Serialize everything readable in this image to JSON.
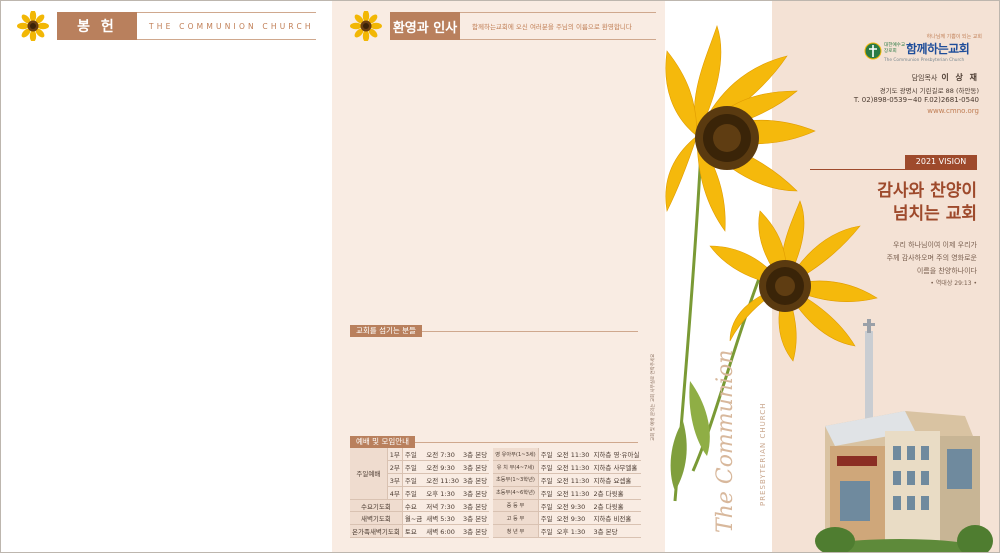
{
  "offering": {
    "tab_label": "봉 헌",
    "subtitle": "THE COMMUNION CHURCH"
  },
  "welcome": {
    "tab_label": "환영과 인사",
    "subtitle": "함께하는교회에 오신 여러분을 주님의 이름으로 환영합니다",
    "serve_section": "교회를 섬기는 분들",
    "worship_section": "예배 및 모임안내",
    "side_note": "교회 및 예배 문의는 교회 사무실로 연락주세요"
  },
  "schedule": {
    "left": [
      {
        "cat": "주일예배",
        "sub": "1부",
        "day": "주일",
        "time": "오전 7:30",
        "place": "3층 본당"
      },
      {
        "cat": "",
        "sub": "2부",
        "day": "주일",
        "time": "오전 9:30",
        "place": "3층 본당"
      },
      {
        "cat": "",
        "sub": "3부",
        "day": "주일",
        "time": "오전 11:30",
        "place": "3층 본당"
      },
      {
        "cat": "",
        "sub": "4부",
        "day": "주일",
        "time": "오후 1:30",
        "place": "3층 본당"
      },
      {
        "cat": "수요기도회",
        "sub": "",
        "day": "수요",
        "time": "저녁 7:30",
        "place": "3층 본당"
      },
      {
        "cat": "새벽기도회",
        "sub": "",
        "day": "월~금",
        "time": "새벽 5:30",
        "place": "3층 본당"
      },
      {
        "cat": "온가족새벽기도회",
        "sub": "",
        "day": "토요",
        "time": "새벽 6:00",
        "place": "3층 본당"
      }
    ],
    "right": [
      {
        "cat": "영 유아부(1~3세)",
        "day": "주일",
        "time": "오전 11:30",
        "place": "지하층 영·유아실"
      },
      {
        "cat": "유 치 부(4~7세)",
        "day": "주일",
        "time": "오전 11:30",
        "place": "지하층 사무엘홀"
      },
      {
        "cat": "초등부(1~3학년)",
        "day": "주일",
        "time": "오전 11:30",
        "place": "지하층 요셉홀"
      },
      {
        "cat": "초등부(4~6학년)",
        "day": "주일",
        "time": "오전 11:30",
        "place": "2층 다윗홀"
      },
      {
        "cat": "중 등 부",
        "day": "주일",
        "time": "오전 9:30",
        "place": "2층 다윗홀"
      },
      {
        "cat": "고 등 부",
        "day": "주일",
        "time": "오전 9:30",
        "place": "지하층 비전홀"
      },
      {
        "cat": "청 년 부",
        "day": "주일",
        "time": "오후 1:30",
        "place": "3층 본당"
      }
    ]
  },
  "cover": {
    "slogan": "하나님께 기쁨이 되는 교회",
    "denomination": "대한예수교 장로회",
    "church_name": "함께하는교회",
    "church_name_en": "The Communion Presbyterian Church",
    "pastor_label": "담임목사",
    "pastor_name": "이 상 재",
    "address": "경기도 광명시 기린길로 88 (하안동)",
    "tel": "T. 02)898-0539~40  F.02)2681-0540",
    "web": "www.cmno.org",
    "vision_label": "2021 VISION",
    "title_line1": "감사와 찬양이",
    "title_line2": "넘치는 교회",
    "verse_line1": "우리 하나님이여 이제 우리가",
    "verse_line2": "주께 감사하오며 주의 영화로운",
    "verse_line3": "이름을 찬양하나이다",
    "verse_ref": "• 역대상 29:13 •",
    "vertical_title": "The Communion",
    "vertical_sub": "PRESBYTERIAN CHURCH"
  },
  "colors": {
    "accent": "#b9805d",
    "title": "#9e4a2c",
    "panel_bg": "#f9ece3",
    "band_bg": "#f4e2d5",
    "logo_blue": "#1e4d9a"
  }
}
